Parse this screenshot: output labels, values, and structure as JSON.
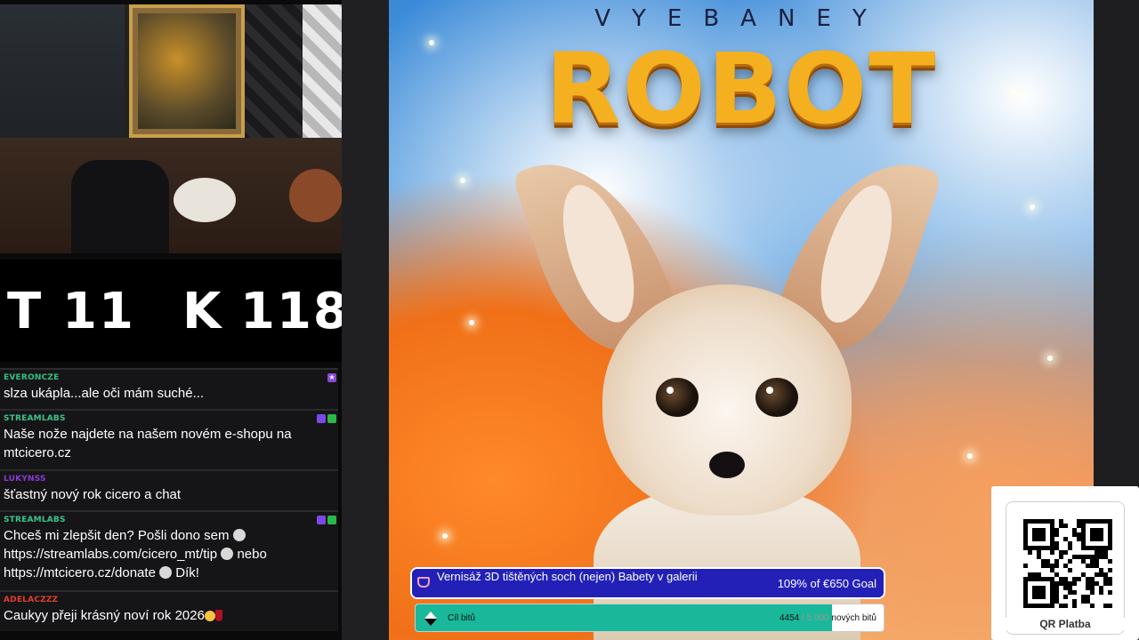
{
  "counter": {
    "t_label": "T",
    "t_value": "11",
    "k_label": "K",
    "k_value": "118"
  },
  "chat": [
    {
      "user": "EVERONCZE",
      "user_color": "#2ec27e",
      "text": "slza ukápla...ale oči mám suché..."
    },
    {
      "user": "STREAMLABS",
      "user_color": "#3cc48a",
      "text": "Naše nože najdete na našem novém e-shopu na mtcicero.cz"
    },
    {
      "user": "LUKYNSS",
      "user_color": "#8a3ad8",
      "text": "šťastný nový rok cicero a chat"
    },
    {
      "user": "STREAMLABS",
      "user_color": "#3cc48a",
      "text_a": "Chceš mi zlepšit den? Pošli dono sem",
      "text_b": "https://streamlabs.com/cicero_mt/tip",
      "text_c": "nebo",
      "text_d": "https://mtcicero.cz/donate",
      "text_e": "Dík!"
    },
    {
      "user": "ADELACZZZ",
      "user_color": "#e0402a",
      "text": "Caukyy přeji krásný noví rok 2026"
    }
  ],
  "art": {
    "subtitle": "VYEBANEY",
    "title": "ROBOT"
  },
  "goal_main": {
    "title": "Vernisáž 3D tištěných soch (nejen) Babety v galerii",
    "amount": "109% of €650 Goal",
    "progress": 1.0
  },
  "goal_bits": {
    "label": "Cíl bitů",
    "current": "4454",
    "separator": "/",
    "target": "5 000",
    "suffix": "nových bitů",
    "progress": 0.89
  },
  "qr": {
    "label": "QR Platba"
  },
  "colors": {
    "goal_main_bg": "#1c1a8c",
    "goal_bits_fill": "#1ab89a",
    "robot_gold": "#f5b020"
  }
}
